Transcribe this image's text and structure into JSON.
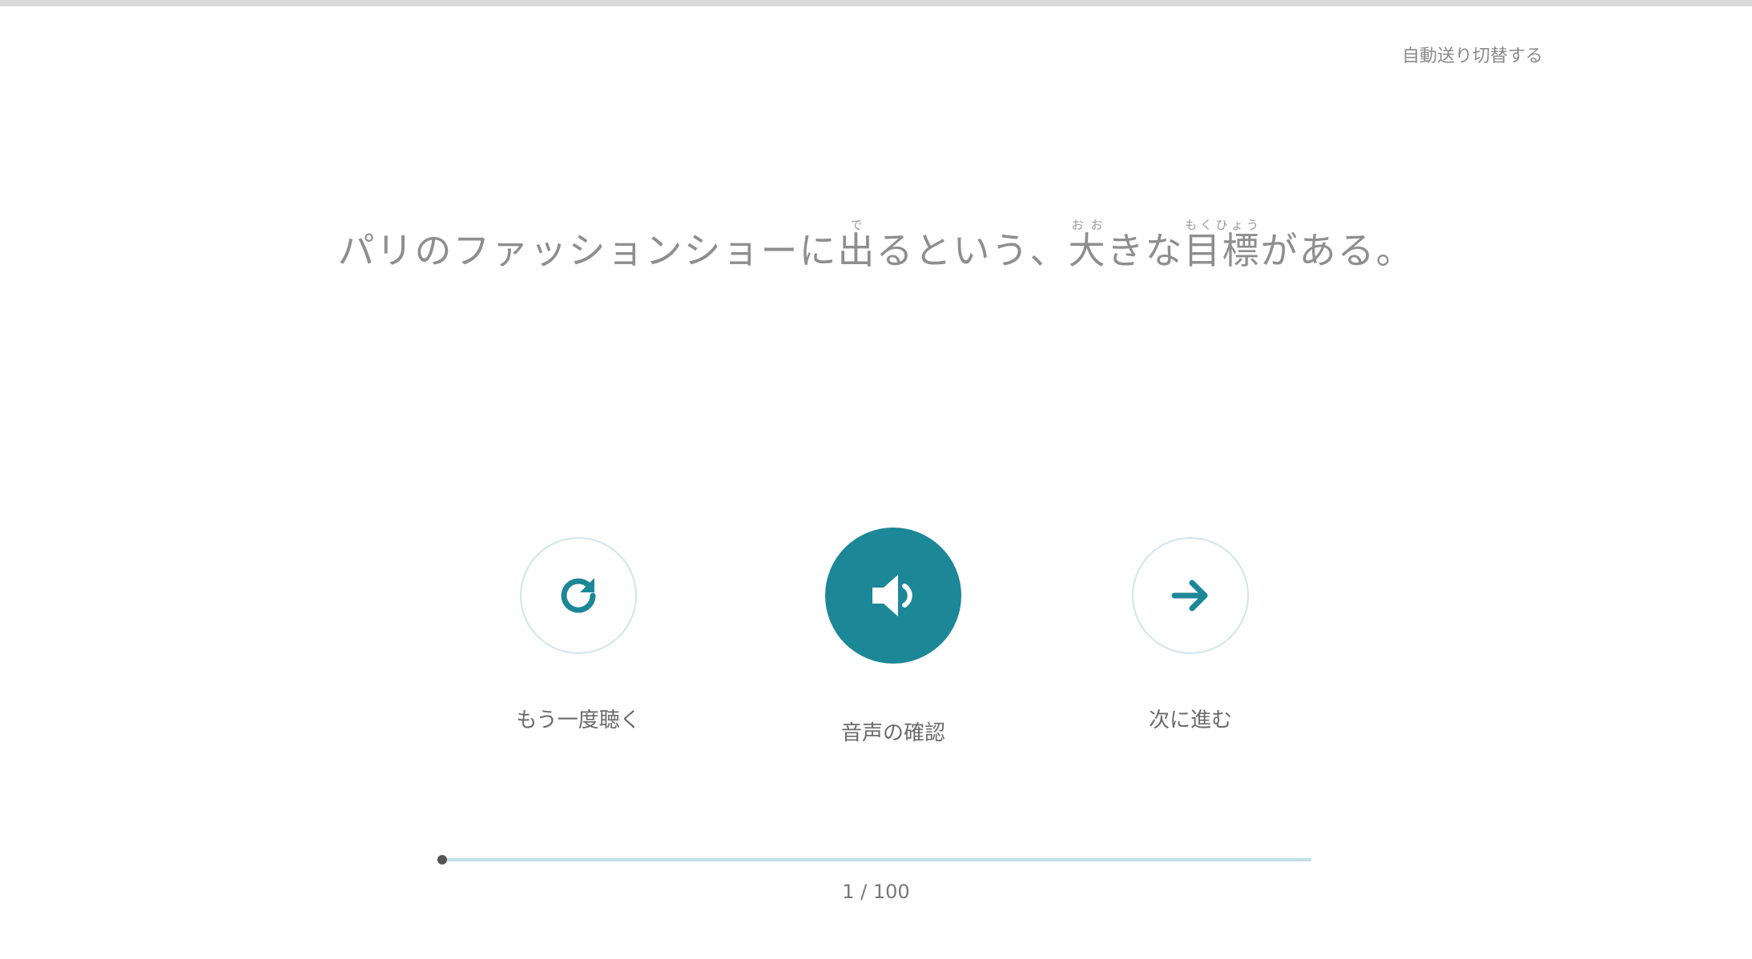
{
  "header": {
    "link_label": "自動送り切替する"
  },
  "sentence": {
    "segments": [
      {
        "text": "パリのファッションショーに"
      },
      {
        "text": "出",
        "ruby": "で"
      },
      {
        "text": "るという、"
      },
      {
        "text": "大",
        "ruby": "おお"
      },
      {
        "text": "きな"
      },
      {
        "text": "目標",
        "ruby": "もくひょう"
      },
      {
        "text": "がある。"
      }
    ]
  },
  "controls": {
    "replay": {
      "label": "もう一度聴く",
      "icon": "refresh-icon"
    },
    "audio": {
      "label": "音声の確認",
      "icon": "speaker-icon"
    },
    "next": {
      "label": "次に進む",
      "icon": "arrow-right-icon"
    }
  },
  "progress": {
    "text": "1 / 100",
    "current": 1,
    "total": 100
  },
  "colors": {
    "accent": "#1c8797",
    "accent_light": "#bfe1e8",
    "text": "#8e8e8e"
  }
}
